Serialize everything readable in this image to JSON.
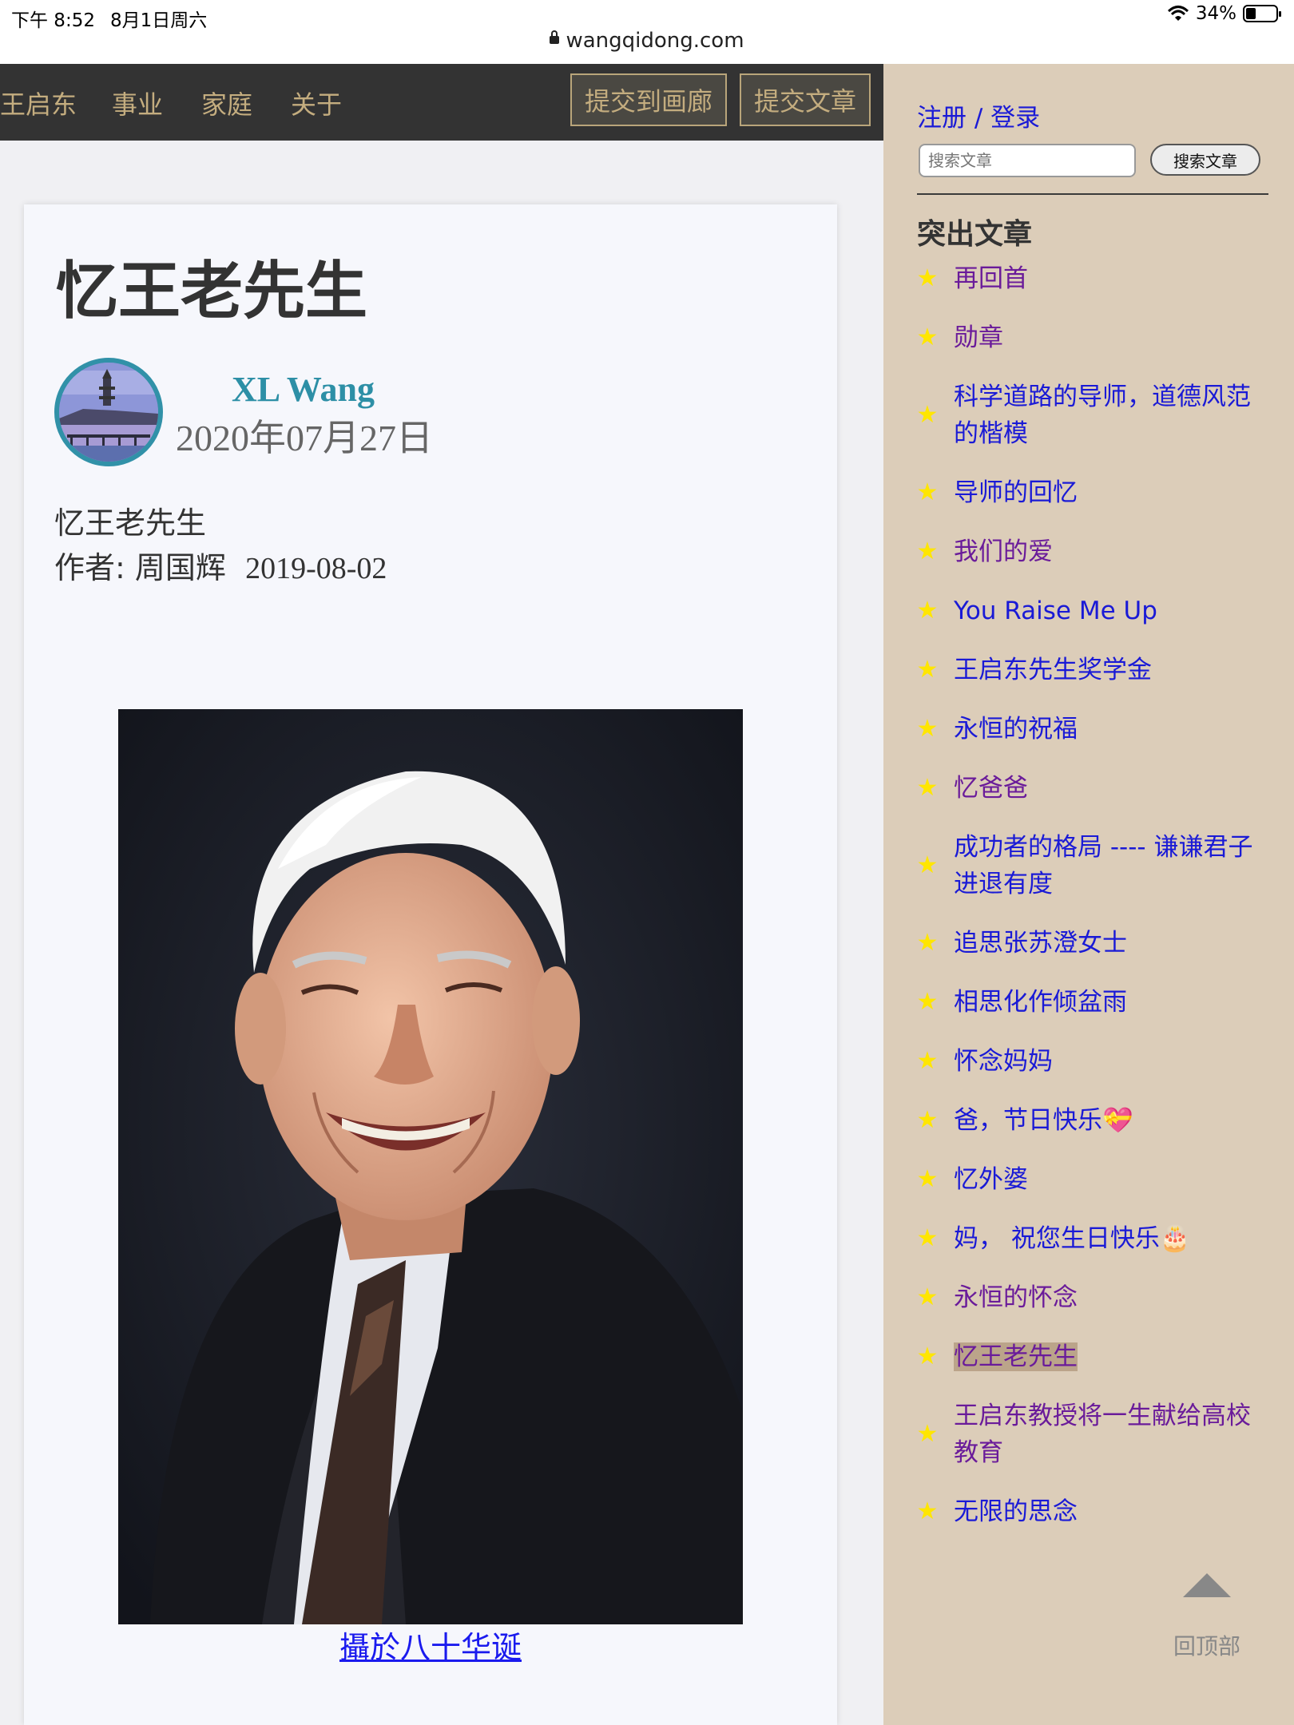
{
  "status_bar": {
    "time": "下午 8:52",
    "date": "8月1日周六",
    "battery": "34%",
    "battery_level": 0.34,
    "url": "wangqidong.com"
  },
  "nav": {
    "items": [
      "王启东",
      "事业",
      "家庭",
      "关于"
    ],
    "submit_gallery": "提交到画廊",
    "submit_article": "提交文章"
  },
  "article": {
    "title": "忆王老先生",
    "author": "XL Wang",
    "date": "2020年07月27日",
    "subtitle": "忆王老先生",
    "byline_prefix": "作者: 周国辉",
    "byline_date": "2019-08-02",
    "caption": "攝於八十华诞"
  },
  "sidebar": {
    "register_login": "注册 / 登录",
    "search_placeholder": "搜索文章",
    "search_button": "搜索文章",
    "featured_heading": "突出文章",
    "featured": [
      {
        "label": "再回首",
        "visited": true
      },
      {
        "label": "勋章",
        "visited": true
      },
      {
        "label": "科学道路的导师，道德风范的楷模",
        "visited": false
      },
      {
        "label": "导师的回忆",
        "visited": false
      },
      {
        "label": "我们的爱",
        "visited": true
      },
      {
        "label": "You Raise Me Up",
        "visited": false
      },
      {
        "label": "王启东先生奖学金",
        "visited": false
      },
      {
        "label": "永恒的祝福",
        "visited": false
      },
      {
        "label": "忆爸爸",
        "visited": true
      },
      {
        "label": "成功者的格局 ---- 谦谦君子进退有度",
        "visited": false
      },
      {
        "label": "追思张苏澄女士",
        "visited": false
      },
      {
        "label": "相思化作倾盆雨",
        "visited": false
      },
      {
        "label": "怀念妈妈",
        "visited": false
      },
      {
        "label": "爸，节日快乐💝",
        "visited": false
      },
      {
        "label": "忆外婆",
        "visited": false
      },
      {
        "label": "妈，  祝您生日快乐🎂",
        "visited": false
      },
      {
        "label": "永恒的怀念",
        "visited": true
      },
      {
        "label": "忆王老先生",
        "visited": true,
        "active": true
      },
      {
        "label": "王启东教授将一生献给高校教育",
        "visited": true
      },
      {
        "label": "无限的思念",
        "visited": false
      }
    ],
    "back_to_top": "回顶部"
  }
}
